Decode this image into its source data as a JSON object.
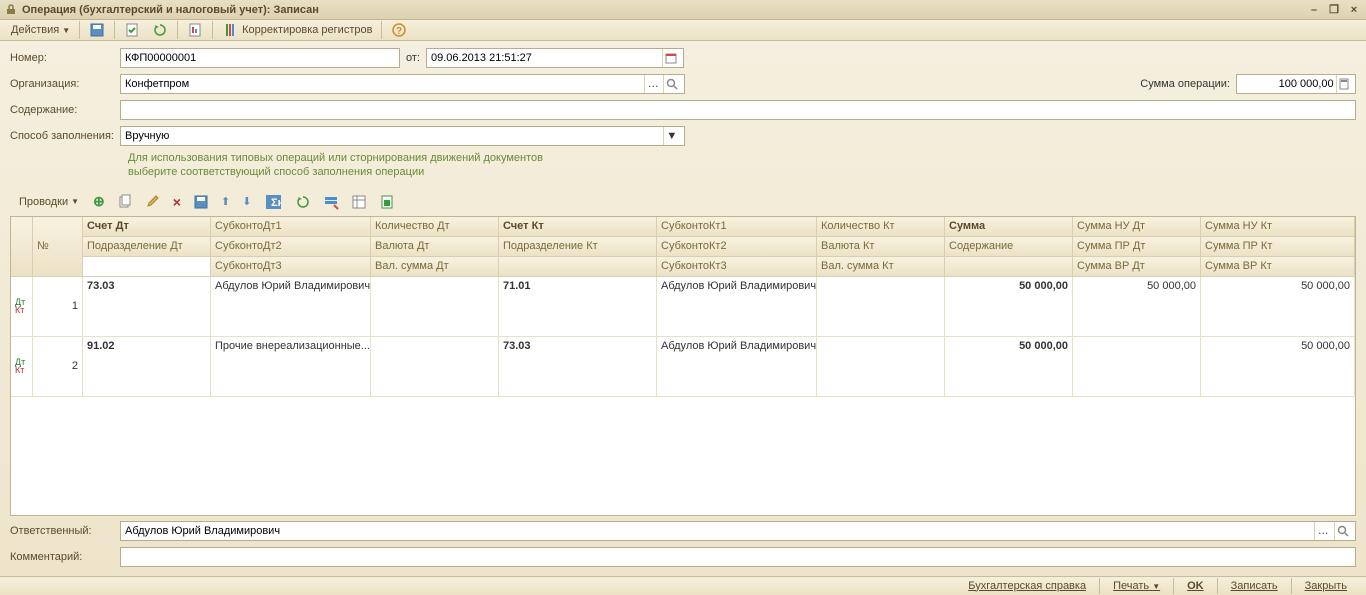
{
  "title": "Операция (бухгалтерский и налоговый учет): Записан",
  "toolbar": {
    "actions": "Действия",
    "register_correction": "Корректировка регистров"
  },
  "labels": {
    "number": "Номер:",
    "date_from": "от:",
    "organization": "Организация:",
    "content": "Содержание:",
    "fill_method": "Способ заполнения:",
    "responsible": "Ответственный:",
    "comment": "Комментарий:",
    "sum_operation": "Сумма операции:"
  },
  "values": {
    "number": "КФП00000001",
    "date": "09.06.2013 21:51:27",
    "organization": "Конфетпром",
    "content": "",
    "fill_method": "Вручную",
    "responsible": "Абдулов Юрий Владимирович",
    "comment": "",
    "sum_operation": "100 000,00"
  },
  "hint": {
    "line1": "Для использования типовых операций или сторнирования движений документов",
    "line2": "выберите соответствующий способ заполнения операции"
  },
  "postings_label": "Проводки",
  "grid": {
    "headers": {
      "num": "№",
      "acct_dt": "Счет Дт",
      "dept_dt": "Подразделение Дт",
      "sub_dt1": "СубконтоДт1",
      "sub_dt2": "СубконтоДт2",
      "sub_dt3": "СубконтоДт3",
      "qty_dt": "Количество Дт",
      "cur_dt": "Валюта Дт",
      "cursum_dt": "Вал. сумма Дт",
      "acct_kt": "Счет Кт",
      "dept_kt": "Подразделение Кт",
      "sub_kt1": "СубконтоКт1",
      "sub_kt2": "СубконтоКт2",
      "sub_kt3": "СубконтоКт3",
      "qty_kt": "Количество Кт",
      "cur_kt": "Валюта Кт",
      "cursum_kt": "Вал. сумма Кт",
      "sum": "Сумма",
      "content_h": "Содержание",
      "sum_nu_dt": "Сумма НУ Дт",
      "sum_pr_dt": "Сумма ПР Дт",
      "sum_vr_dt": "Сумма ВР Дт",
      "sum_nu_kt": "Сумма НУ Кт",
      "sum_pr_kt": "Сумма ПР Кт",
      "sum_vr_kt": "Сумма ВР Кт"
    },
    "rows": [
      {
        "num": "1",
        "acct_dt": "73.03",
        "sub_dt1": "Абдулов Юрий Владимирович",
        "acct_kt": "71.01",
        "sub_kt1": "Абдулов Юрий Владимирович",
        "sum": "50 000,00",
        "sum_nu_dt": "50 000,00",
        "sum_nu_kt": "50 000,00"
      },
      {
        "num": "2",
        "acct_dt": "91.02",
        "sub_dt1": "Прочие внереализационные...",
        "acct_kt": "73.03",
        "sub_kt1": "Абдулов Юрий Владимирович",
        "sum": "50 000,00",
        "sum_nu_dt": "",
        "sum_nu_kt": "50 000,00"
      }
    ]
  },
  "footer": {
    "accounting_ref": "Бухгалтерская справка",
    "print": "Печать",
    "ok": "OK",
    "save": "Записать",
    "close": "Закрыть"
  }
}
